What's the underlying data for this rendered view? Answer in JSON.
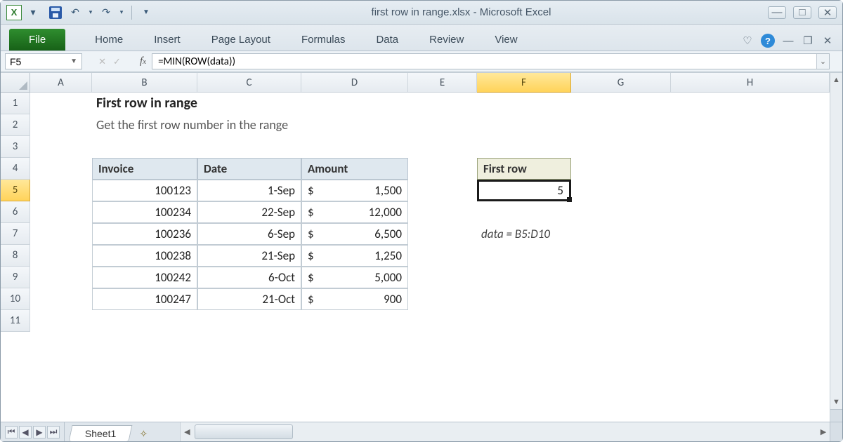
{
  "titlebar": {
    "app_icon_letter": "X",
    "title": "first row in range.xlsx  -  Microsoft Excel"
  },
  "ribbon": {
    "file": "File",
    "tabs": [
      "Home",
      "Insert",
      "Page Layout",
      "Formulas",
      "Data",
      "Review",
      "View"
    ]
  },
  "namebox": "F5",
  "formula": "=MIN(ROW(data))",
  "columns": [
    "A",
    "B",
    "C",
    "D",
    "E",
    "F",
    "G",
    "H"
  ],
  "rows": [
    "1",
    "2",
    "3",
    "4",
    "5",
    "6",
    "7",
    "8",
    "9",
    "10",
    "11"
  ],
  "active": {
    "col": "F",
    "row": "5"
  },
  "content": {
    "title": "First row in range",
    "subtitle": "Get the first row number in the range",
    "headers": {
      "invoice": "Invoice",
      "date": "Date",
      "amount": "Amount"
    },
    "table": [
      {
        "invoice": "100123",
        "date": "1-Sep",
        "currency": "$",
        "amount": "1,500"
      },
      {
        "invoice": "100234",
        "date": "22-Sep",
        "currency": "$",
        "amount": "12,000"
      },
      {
        "invoice": "100236",
        "date": "6-Sep",
        "currency": "$",
        "amount": "6,500"
      },
      {
        "invoice": "100238",
        "date": "21-Sep",
        "currency": "$",
        "amount": "1,250"
      },
      {
        "invoice": "100242",
        "date": "6-Oct",
        "currency": "$",
        "amount": "5,000"
      },
      {
        "invoice": "100247",
        "date": "21-Oct",
        "currency": "$",
        "amount": "900"
      }
    ],
    "result_label": "First row",
    "result_value": "5",
    "note": "data = B5:D10"
  },
  "sheet_tab": "Sheet1"
}
